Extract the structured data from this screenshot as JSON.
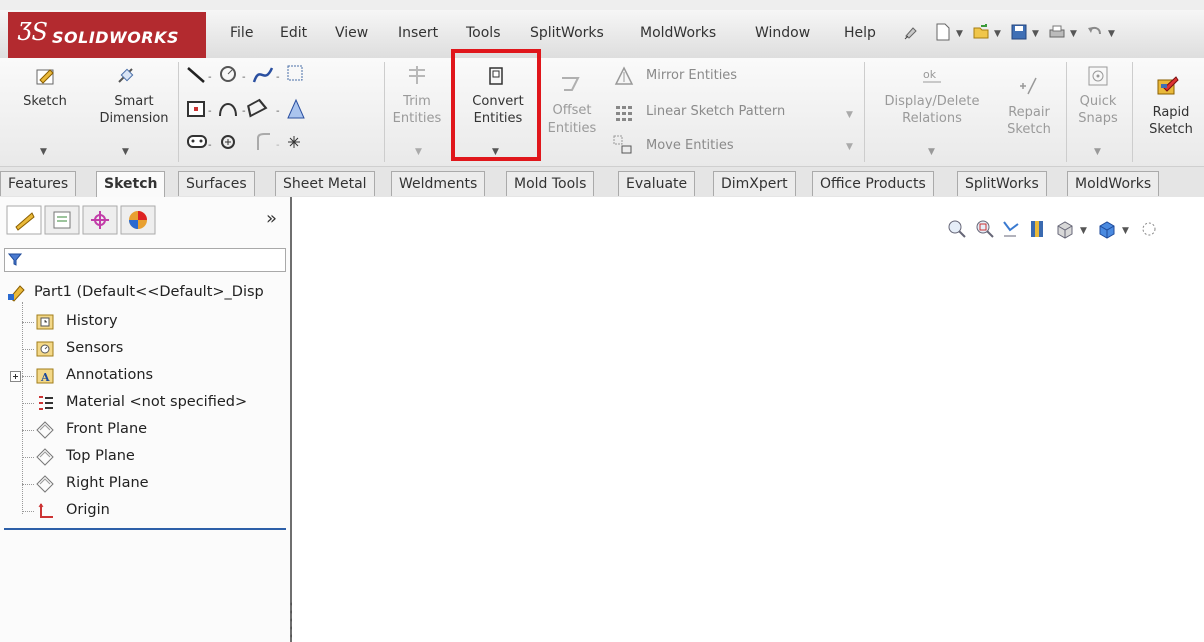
{
  "app": {
    "logo_ds": "ƷS",
    "logo_text": "SOLIDWORKS"
  },
  "menu": [
    "File",
    "Edit",
    "View",
    "Insert",
    "Tools",
    "SplitWorks",
    "MoldWorks",
    "Window",
    "Help"
  ],
  "quick_access": [
    "pin-icon",
    "new-document-icon",
    "open-folder-icon",
    "save-icon",
    "print-icon",
    "undo-icon"
  ],
  "ribbon": {
    "sketch": "Sketch",
    "smart_dimension_1": "Smart",
    "smart_dimension_2": "Dimension",
    "trim_1": "Trim",
    "trim_2": "Entities",
    "convert_1": "Convert",
    "convert_2": "Entities",
    "offset_1": "Offset",
    "offset_2": "Entities",
    "mirror": "Mirror Entities",
    "linear_pattern": "Linear Sketch Pattern",
    "move": "Move Entities",
    "display_delete_1": "Display/Delete",
    "display_delete_2": "Relations",
    "repair_1": "Repair",
    "repair_2": "Sketch",
    "quick_snaps_1": "Quick",
    "quick_snaps_2": "Snaps",
    "rapid_1": "Rapid",
    "rapid_2": "Sketch",
    "highlight_color": "#e0161b"
  },
  "tabs": [
    {
      "label": "Features",
      "active": false
    },
    {
      "label": "Sketch",
      "active": true
    },
    {
      "label": "Surfaces",
      "active": false
    },
    {
      "label": "Sheet Metal",
      "active": false
    },
    {
      "label": "Weldments",
      "active": false
    },
    {
      "label": "Mold Tools",
      "active": false
    },
    {
      "label": "Evaluate",
      "active": false
    },
    {
      "label": "DimXpert",
      "active": false
    },
    {
      "label": "Office Products",
      "active": false
    },
    {
      "label": "SplitWorks",
      "active": false
    },
    {
      "label": "MoldWorks",
      "active": false
    }
  ],
  "panel": {
    "expand": "»"
  },
  "tree": {
    "root": "Part1  (Default<<Default>_Disp",
    "items": [
      {
        "label": "History",
        "icon": "history-icon"
      },
      {
        "label": "Sensors",
        "icon": "sensors-icon"
      },
      {
        "label": "Annotations",
        "icon": "annotations-icon",
        "expandable": true
      },
      {
        "label": "Material <not specified>",
        "icon": "material-icon"
      },
      {
        "label": "Front Plane",
        "icon": "plane-icon"
      },
      {
        "label": "Top Plane",
        "icon": "plane-icon"
      },
      {
        "label": "Right Plane",
        "icon": "plane-icon"
      },
      {
        "label": "Origin",
        "icon": "origin-icon"
      }
    ]
  }
}
